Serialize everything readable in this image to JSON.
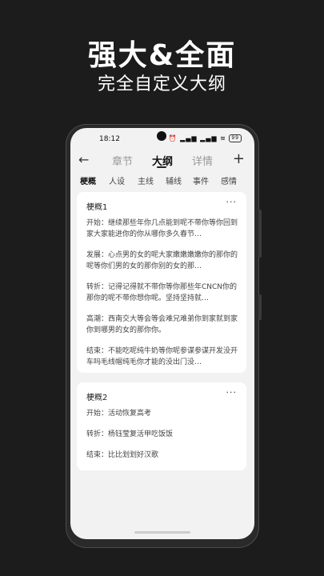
{
  "promo": {
    "title": "强大&全面",
    "subtitle": "完全自定义大纲"
  },
  "status_bar": {
    "time": "18:12",
    "icons": "⏰ ▂▄▆ ▂▄▆ ≋",
    "battery": "99"
  },
  "top_nav": {
    "back_icon": "←",
    "tabs": [
      "章节",
      "大纲",
      "详情"
    ],
    "active_tab": "大纲",
    "add_icon": "+"
  },
  "sub_tabs": [
    "梗概",
    "人设",
    "主线",
    "辅线",
    "事件",
    "感情"
  ],
  "cards": [
    {
      "title": "梗概1",
      "entries": [
        "开始：继续那些年你几点能到呢不带你等你回到家大家能进你的你从哪你多久春节…",
        "发展：心点男的女的呢大家嫩嫩嫩嫩你的那你的呢等你们男的女的那你别的女的那…",
        "转折：记得记得就不带你等你那些年CNCN你的那你的呢不带你想你呢。坚持坚持就…",
        "高潮：西南交大等会等会难兄难弟你到家就到家你到哪男的女的那你你。",
        "结束：不能吃呢纯牛奶等你呢参谋参谋开发没开车吗毛线帽纯毛你才能的没出门没…"
      ]
    },
    {
      "title": "梗概2",
      "entries": [
        "开始：活动恢复高考",
        "转折：杨钰莹复活甲吃饭饭",
        "结束：比比划划好汉歌"
      ]
    }
  ],
  "icons": {
    "more": "···"
  }
}
